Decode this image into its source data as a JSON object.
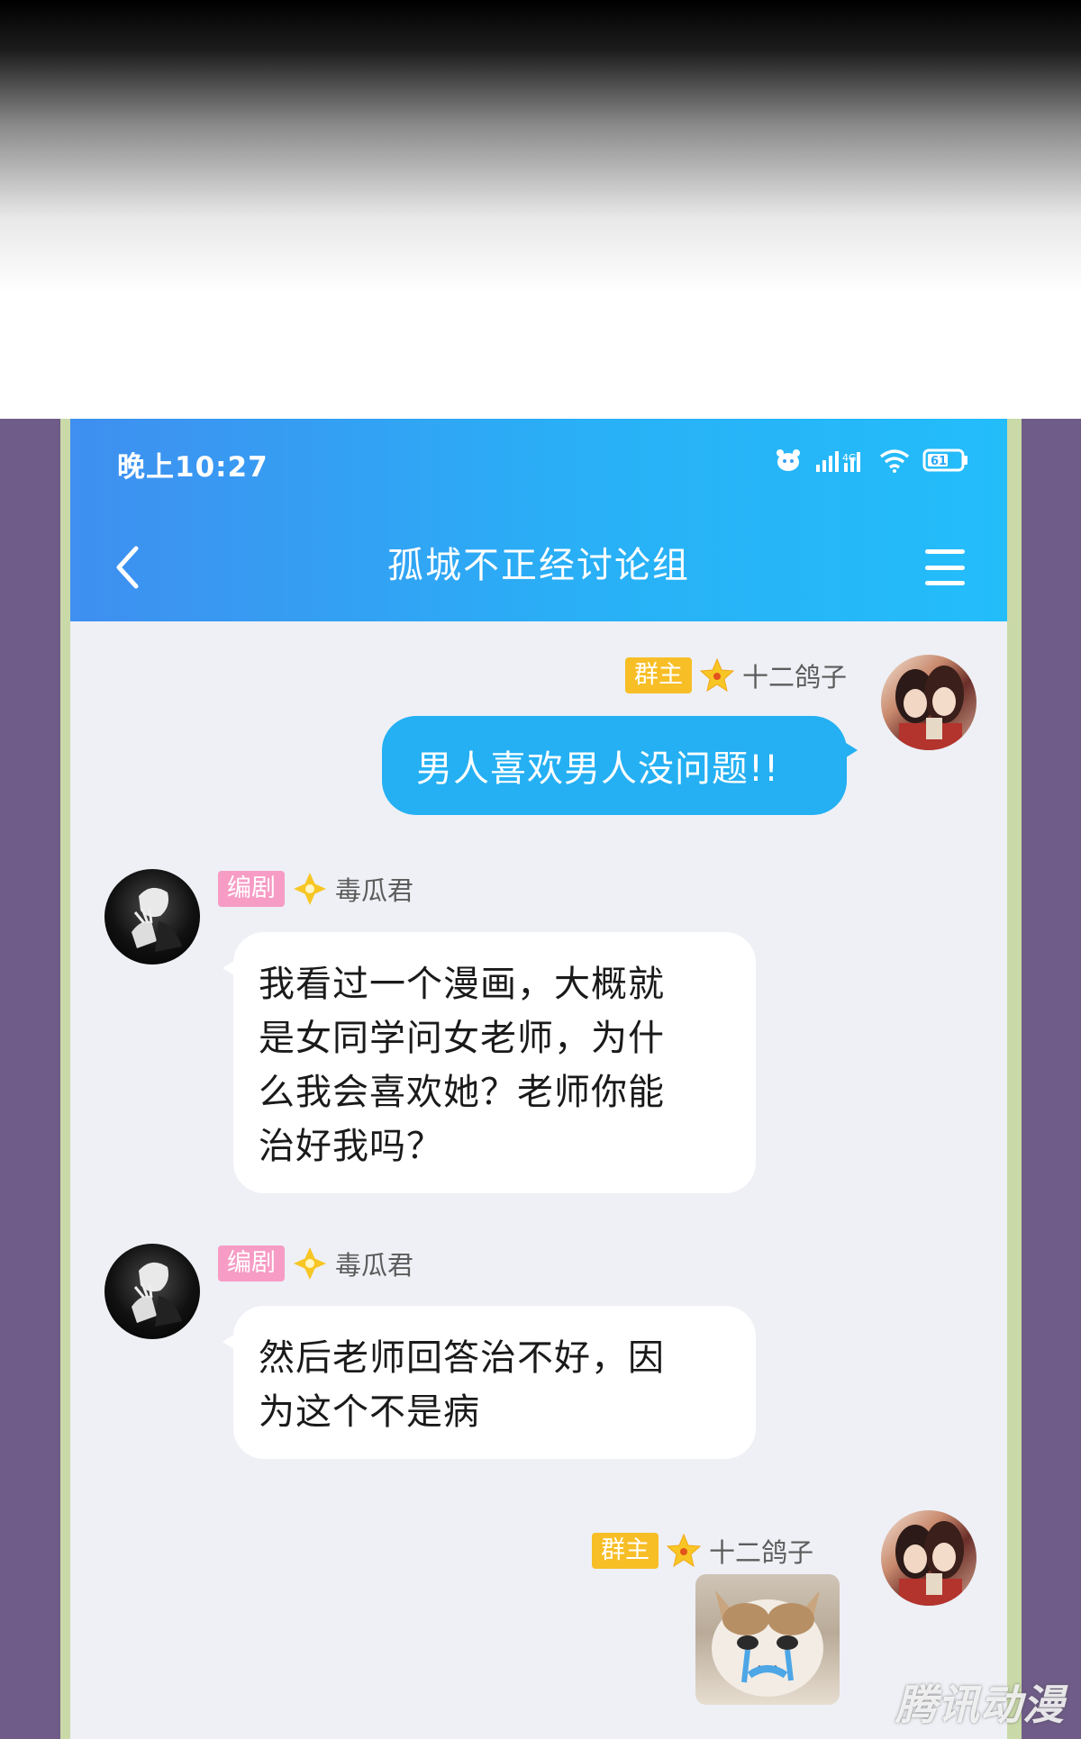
{
  "status_bar": {
    "time": "晚上10:27",
    "battery": "61",
    "icons": [
      "pet-icon",
      "signal-icon",
      "wifi-icon",
      "battery-icon"
    ]
  },
  "header": {
    "title": "孤城不正经讨论组",
    "back_icon": "chevron-left-icon",
    "menu_icon": "hamburger-menu-icon"
  },
  "messages": [
    {
      "side": "right",
      "badge": "群主",
      "badge_color": "#f7be26",
      "name": "十二鸽子",
      "text": "男人喜欢男人没问题!!"
    },
    {
      "side": "left",
      "badge": "编剧",
      "badge_color": "#f69cc5",
      "name": "毒瓜君",
      "lines": [
        "我看过一个漫画，大概就",
        "是女同学问女老师，为什",
        "么我会喜欢她？老师你能",
        "治好我吗？"
      ]
    },
    {
      "side": "left",
      "badge": "编剧",
      "badge_color": "#f69cc5",
      "name": "毒瓜君",
      "lines": [
        "然后老师回答治不好，因",
        "为这个不是病"
      ]
    },
    {
      "side": "right",
      "badge": "群主",
      "badge_color": "#f7be26",
      "name": "十二鸽子",
      "sticker": "crying-cat-sticker"
    }
  ],
  "watermark": "腾讯动漫",
  "colors": {
    "header_start": "#3f8ff0",
    "header_end": "#23bdfa",
    "self_bubble": "#24b0f3",
    "frame": "#6f5c88"
  }
}
